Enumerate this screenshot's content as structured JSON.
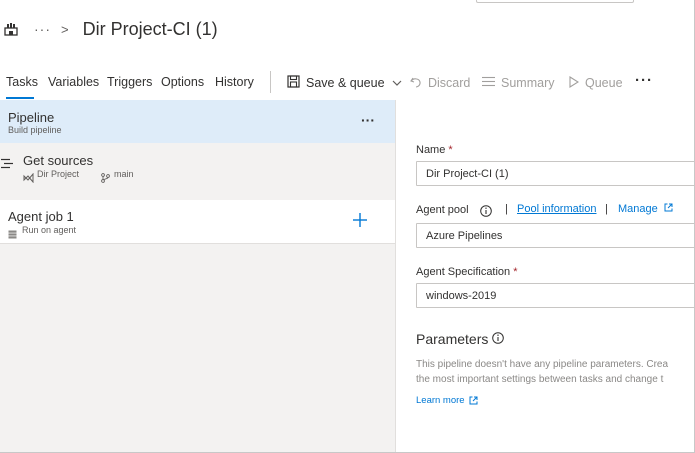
{
  "breadcrumb": {
    "project_icon": "org-project-icon",
    "more": "···",
    "separator": ">",
    "title": "Dir Project-CI (1)"
  },
  "tabs": [
    {
      "label": "Tasks",
      "active": true
    },
    {
      "label": "Variables"
    },
    {
      "label": "Triggers"
    },
    {
      "label": "Options"
    },
    {
      "label": "History"
    }
  ],
  "toolbar": {
    "save_queue": {
      "label": "Save & queue",
      "icon": "save-icon"
    },
    "discard": {
      "label": "Discard",
      "icon": "undo-icon"
    },
    "summary": {
      "label": "Summary",
      "icon": "list-icon"
    },
    "queue": {
      "label": "Queue",
      "icon": "play-icon"
    },
    "more": "···"
  },
  "pipeline": {
    "title": "Pipeline",
    "subtitle": "Build pipeline",
    "more": "···"
  },
  "get_sources": {
    "title": "Get sources",
    "repo": "Dir Project",
    "branch": "main"
  },
  "agent_job": {
    "title": "Agent job 1",
    "subtitle": "Run on agent"
  },
  "form": {
    "name_label": "Name",
    "required_mark": "*",
    "name_value": "Dir Project-CI (1)",
    "agent_pool_label": "Agent pool",
    "separator": "|",
    "pool_information": "Pool information",
    "manage": "Manage",
    "agent_pool_value": "Azure Pipelines",
    "agent_spec_label": "Agent Specification",
    "agent_spec_value": "windows-2019",
    "parameters_title": "Parameters",
    "parameters_desc_line1": "This pipeline doesn't have any pipeline parameters. Crea",
    "parameters_desc_line2": "the most important settings between tasks and change t",
    "learn_more": "Learn more"
  },
  "colors": {
    "accent": "#0078d4",
    "selected_bg": "#deecf9",
    "pane_bg": "#f3f2f1",
    "required": "#a4262c"
  }
}
